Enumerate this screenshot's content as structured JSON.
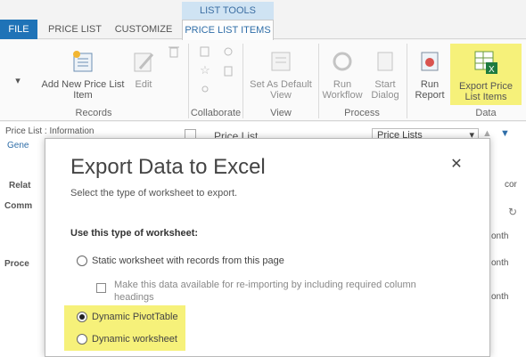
{
  "ribbon": {
    "context_header": "LIST TOOLS",
    "tabs": [
      "FILE",
      "PRICE LIST",
      "CUSTOMIZE",
      "PRICE LIST ITEMS"
    ],
    "groups": [
      "Records",
      "Collaborate",
      "View",
      "Process",
      "Data"
    ],
    "buttons": {
      "add_new": "Add New Price List Item",
      "edit": "Edit",
      "set_default_view": "Set As Default View",
      "run_workflow": "Run Workflow",
      "start_dialog": "Start Dialog",
      "run_report": "Run Report",
      "export": "Export Price List Items"
    }
  },
  "background": {
    "breadcrumb": "Price List : Information",
    "general": "Gene",
    "related": "Relat",
    "comm": "Comm",
    "proce": "Proce",
    "price_list_header": "Price List",
    "dropdown_value": "Price Lists",
    "search_tail": "cor",
    "month1": "onth",
    "month2": "onth",
    "month3": "onth"
  },
  "dialog": {
    "title": "Export Data to Excel",
    "subtitle": "Select the type of worksheet to export.",
    "label": "Use this type of worksheet:",
    "options": {
      "static": "Static worksheet with records from this page",
      "reimport": "Make this data available for re-importing by including required column headings",
      "pivot": "Dynamic PivotTable",
      "dynamic": "Dynamic worksheet"
    },
    "selected": "Dynamic PivotTable"
  },
  "colors": {
    "accent": "#1f73b7",
    "highlight": "#f6f17a"
  }
}
